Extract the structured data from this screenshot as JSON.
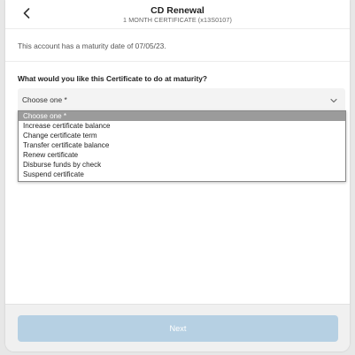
{
  "header": {
    "title": "CD Renewal",
    "subtitle": "1 MONTH CERTIFICATE (x13S0107)",
    "back_icon": "chevron-left-icon"
  },
  "content": {
    "maturity_note": "This account has a maturity date of 07/05/23.",
    "question": "What would you like this Certificate to do at maturity?"
  },
  "select": {
    "value": "Choose one *",
    "chevron_icon": "chevron-down-icon",
    "options": [
      "Choose one *",
      "Increase certificate balance",
      "Change certificate term",
      "Transfer certificate balance",
      "Renew certificate",
      "Disburse funds by check",
      "Suspend certificate"
    ],
    "highlighted_index": 0
  },
  "footer": {
    "next_label": "Next"
  },
  "colors": {
    "next_button_bg": "#b6d0e3",
    "highlight_bg": "#9b9b9b"
  }
}
